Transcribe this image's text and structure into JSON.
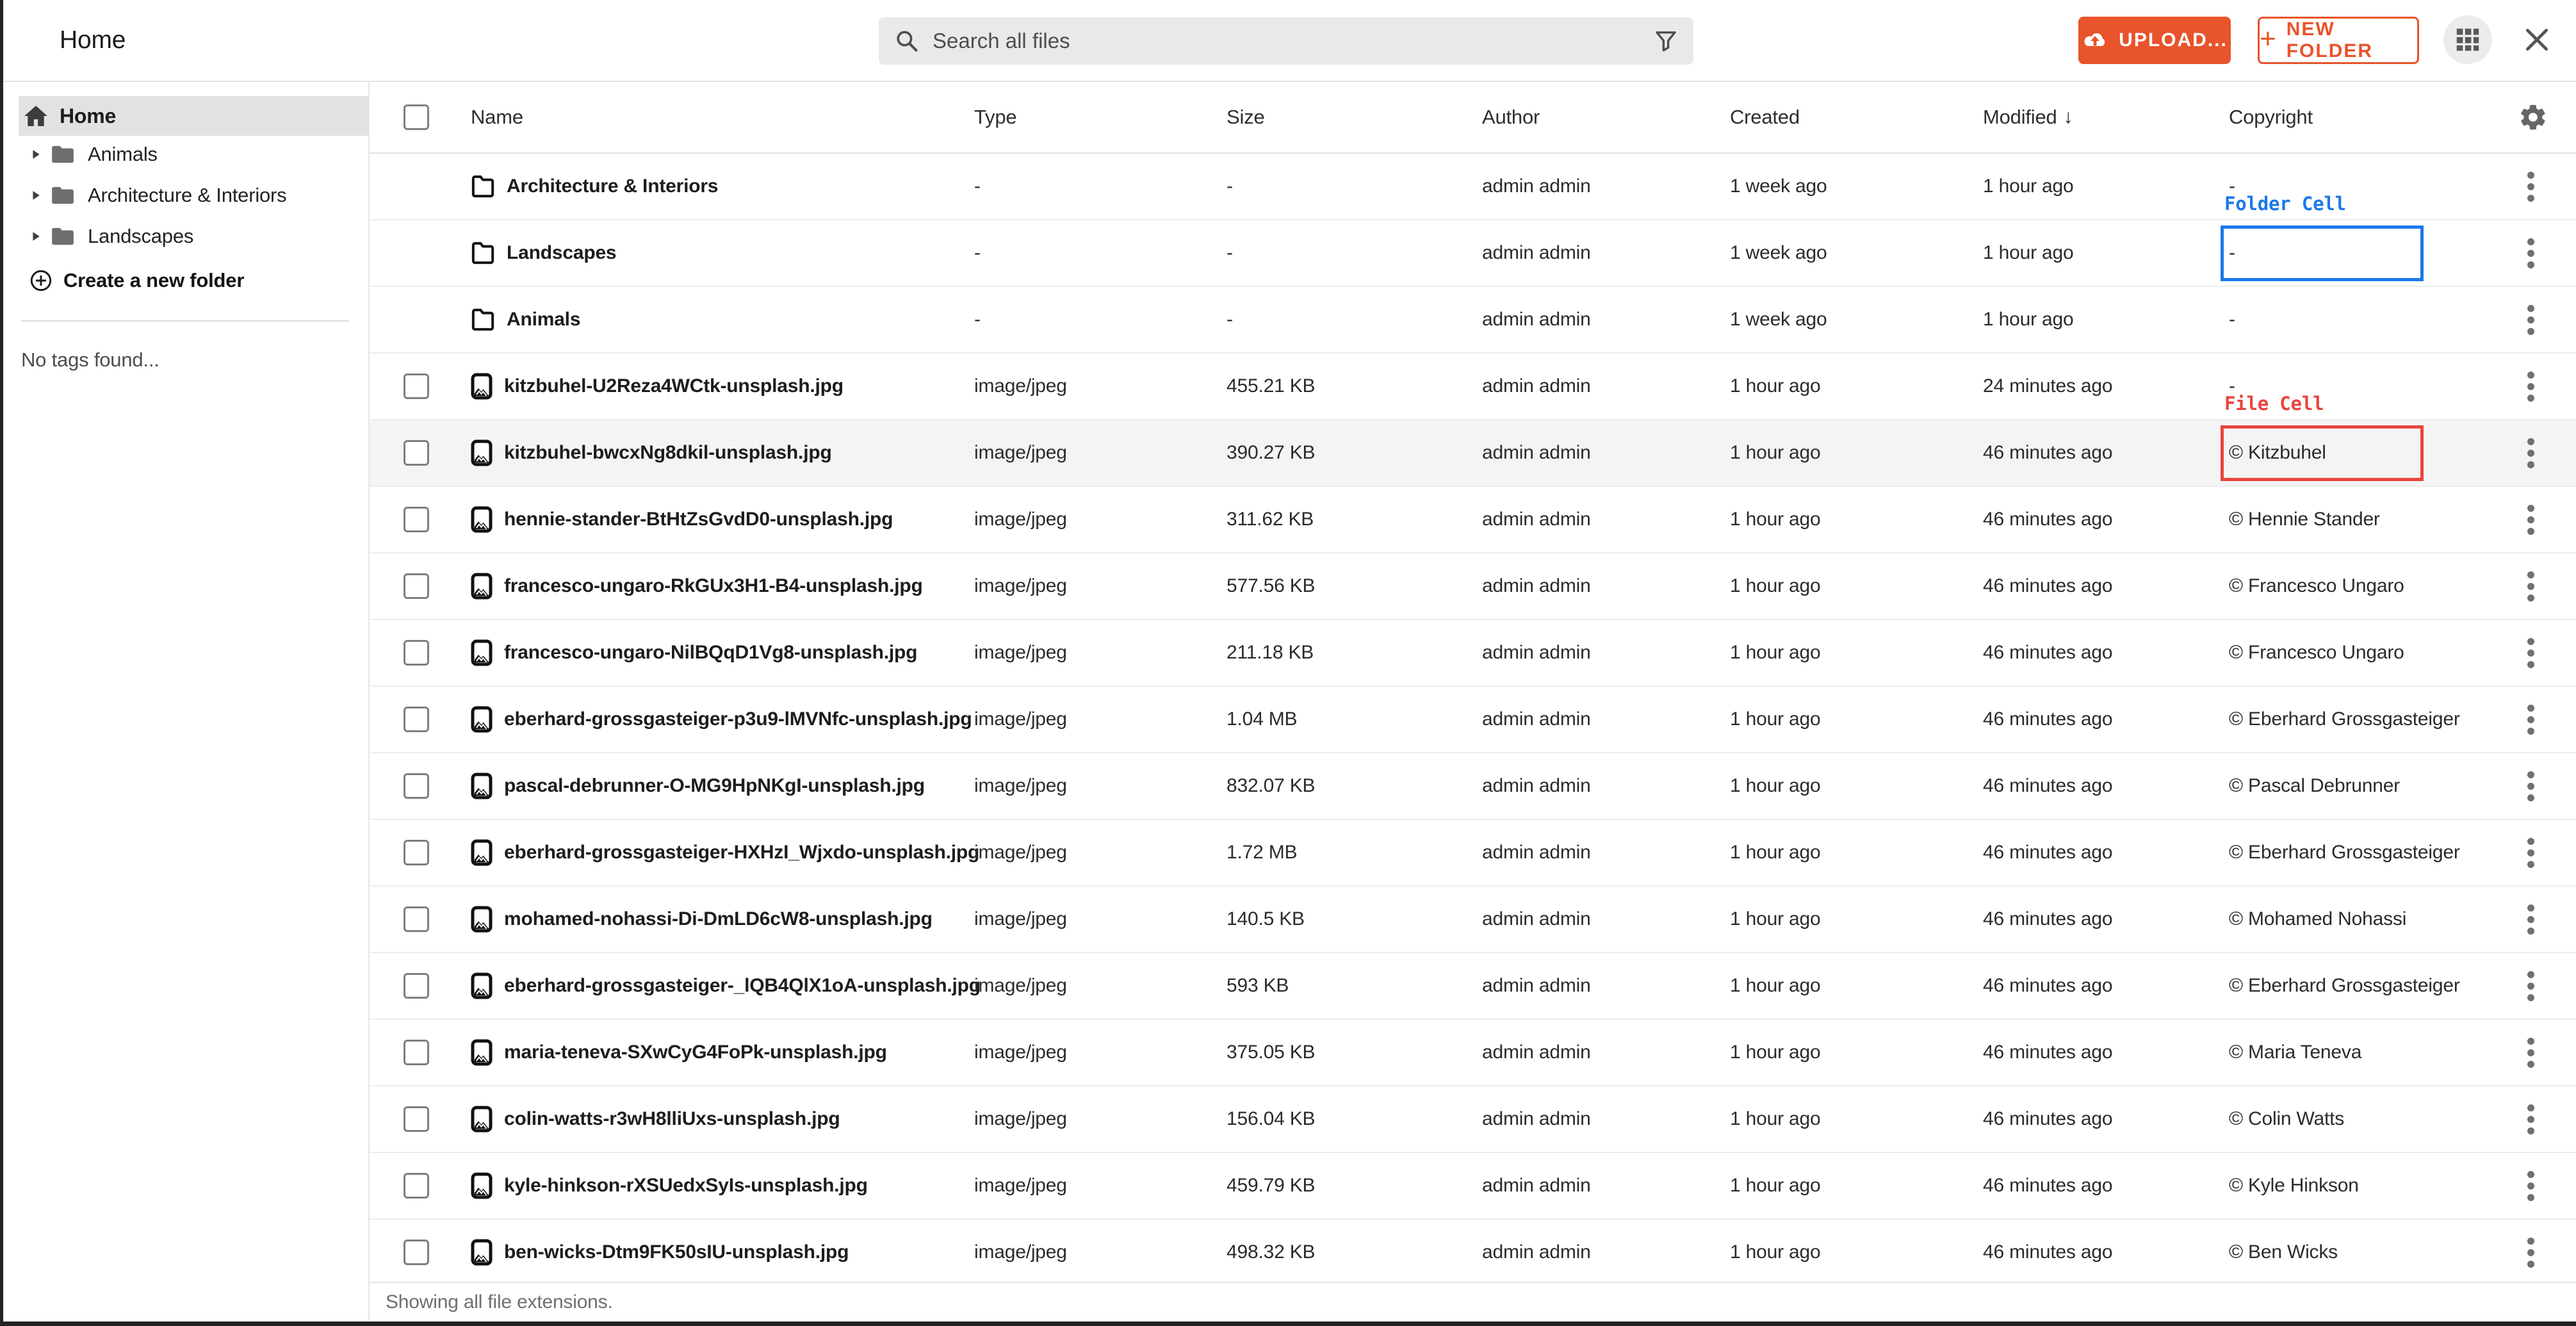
{
  "topbar": {
    "title": "Home",
    "search_placeholder": "Search all files",
    "upload_label": "UPLOAD...",
    "new_folder_label": "NEW FOLDER",
    "new_folder_plus": "+"
  },
  "sidebar": {
    "home_label": "Home",
    "folders": [
      {
        "label": "Animals"
      },
      {
        "label": "Architecture & Interiors"
      },
      {
        "label": "Landscapes"
      }
    ],
    "create_folder_label": "Create a new folder",
    "no_tags_message": "No tags found..."
  },
  "table": {
    "columns": [
      "Name",
      "Type",
      "Size",
      "Author",
      "Created",
      "Modified",
      "Copyright"
    ],
    "sort": {
      "column": "Modified",
      "direction": "desc",
      "indicator": "↓"
    },
    "rows": [
      {
        "kind": "folder",
        "name": "Architecture & Interiors",
        "type": "-",
        "size": "-",
        "author": "admin admin",
        "created": "1 week ago",
        "modified": "1 hour ago",
        "copyright": "-"
      },
      {
        "kind": "folder",
        "name": "Landscapes",
        "type": "-",
        "size": "-",
        "author": "admin admin",
        "created": "1 week ago",
        "modified": "1 hour ago",
        "copyright": "-",
        "annotation": "folder_cell"
      },
      {
        "kind": "folder",
        "name": "Animals",
        "type": "-",
        "size": "-",
        "author": "admin admin",
        "created": "1 week ago",
        "modified": "1 hour ago",
        "copyright": "-"
      },
      {
        "kind": "file",
        "name": "kitzbuhel-U2Reza4WCtk-unsplash.jpg",
        "type": "image/jpeg",
        "size": "455.21 KB",
        "author": "admin admin",
        "created": "1 hour ago",
        "modified": "24 minutes ago",
        "copyright": "-"
      },
      {
        "kind": "file",
        "name": "kitzbuhel-bwcxNg8dkil-unsplash.jpg",
        "type": "image/jpeg",
        "size": "390.27 KB",
        "author": "admin admin",
        "created": "1 hour ago",
        "modified": "46 minutes ago",
        "copyright": "© Kitzbuhel",
        "highlighted": true,
        "annotation": "file_cell"
      },
      {
        "kind": "file",
        "name": "hennie-stander-BtHtZsGvdD0-unsplash.jpg",
        "type": "image/jpeg",
        "size": "311.62 KB",
        "author": "admin admin",
        "created": "1 hour ago",
        "modified": "46 minutes ago",
        "copyright": "© Hennie Stander"
      },
      {
        "kind": "file",
        "name": "francesco-ungaro-RkGUx3H1-B4-unsplash.jpg",
        "type": "image/jpeg",
        "size": "577.56 KB",
        "author": "admin admin",
        "created": "1 hour ago",
        "modified": "46 minutes ago",
        "copyright": "© Francesco Ungaro"
      },
      {
        "kind": "file",
        "name": "francesco-ungaro-NilBQqD1Vg8-unsplash.jpg",
        "type": "image/jpeg",
        "size": "211.18 KB",
        "author": "admin admin",
        "created": "1 hour ago",
        "modified": "46 minutes ago",
        "copyright": "© Francesco Ungaro"
      },
      {
        "kind": "file",
        "name": "eberhard-grossgasteiger-p3u9-lMVNfc-unsplash.jpg",
        "type": "image/jpeg",
        "size": "1.04 MB",
        "author": "admin admin",
        "created": "1 hour ago",
        "modified": "46 minutes ago",
        "copyright": "© Eberhard Grossgasteiger"
      },
      {
        "kind": "file",
        "name": "pascal-debrunner-O-MG9HpNKgI-unsplash.jpg",
        "type": "image/jpeg",
        "size": "832.07 KB",
        "author": "admin admin",
        "created": "1 hour ago",
        "modified": "46 minutes ago",
        "copyright": "© Pascal Debrunner"
      },
      {
        "kind": "file",
        "name": "eberhard-grossgasteiger-HXHzI_Wjxdo-unsplash.jpg",
        "type": "image/jpeg",
        "size": "1.72 MB",
        "author": "admin admin",
        "created": "1 hour ago",
        "modified": "46 minutes ago",
        "copyright": "© Eberhard Grossgasteiger"
      },
      {
        "kind": "file",
        "name": "mohamed-nohassi-Di-DmLD6cW8-unsplash.jpg",
        "type": "image/jpeg",
        "size": "140.5 KB",
        "author": "admin admin",
        "created": "1 hour ago",
        "modified": "46 minutes ago",
        "copyright": "© Mohamed Nohassi"
      },
      {
        "kind": "file",
        "name": "eberhard-grossgasteiger-_lQB4QlX1oA-unsplash.jpg",
        "type": "image/jpeg",
        "size": "593 KB",
        "author": "admin admin",
        "created": "1 hour ago",
        "modified": "46 minutes ago",
        "copyright": "© Eberhard Grossgasteiger"
      },
      {
        "kind": "file",
        "name": "maria-teneva-SXwCyG4FoPk-unsplash.jpg",
        "type": "image/jpeg",
        "size": "375.05 KB",
        "author": "admin admin",
        "created": "1 hour ago",
        "modified": "46 minutes ago",
        "copyright": "© Maria Teneva"
      },
      {
        "kind": "file",
        "name": "colin-watts-r3wH8lliUxs-unsplash.jpg",
        "type": "image/jpeg",
        "size": "156.04 KB",
        "author": "admin admin",
        "created": "1 hour ago",
        "modified": "46 minutes ago",
        "copyright": "© Colin Watts"
      },
      {
        "kind": "file",
        "name": "kyle-hinkson-rXSUedxSyIs-unsplash.jpg",
        "type": "image/jpeg",
        "size": "459.79 KB",
        "author": "admin admin",
        "created": "1 hour ago",
        "modified": "46 minutes ago",
        "copyright": "© Kyle Hinkson"
      },
      {
        "kind": "file",
        "name": "ben-wicks-Dtm9FK50sIU-unsplash.jpg",
        "type": "image/jpeg",
        "size": "498.32 KB",
        "author": "admin admin",
        "created": "1 hour ago",
        "modified": "46 minutes ago",
        "copyright": "© Ben Wicks"
      }
    ],
    "footer": "Showing all file extensions."
  },
  "annotations": {
    "folder_cell": {
      "label": "Folder Cell",
      "color": "#1b78e8"
    },
    "file_cell": {
      "label": "File Cell",
      "color": "#e8453c"
    }
  },
  "colors": {
    "accent": "#e8542c",
    "row_highlight": "#f4f4f4",
    "sidebar_selected": "#e2e2e2"
  },
  "icons": {
    "search": "magnifier",
    "filter": "funnel",
    "upload": "cloud-upload",
    "view_toggle": "grid",
    "close": "x",
    "home": "house",
    "folder_expand": "caret-right",
    "create_folder": "plus-circle",
    "settings": "gear",
    "row_menu": "kebab-vertical",
    "file": "image-thumbnail",
    "folder": "folder-outline"
  }
}
